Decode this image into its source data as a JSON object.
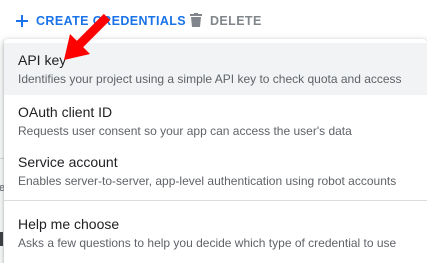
{
  "toolbar": {
    "create_label": "CREATE CREDENTIALS",
    "delete_label": "DELETE"
  },
  "menu": {
    "items": [
      {
        "title": "API key",
        "description": "Identifies your project using a simple API key to check quota and access",
        "highlighted": true
      },
      {
        "title": "OAuth client ID",
        "description": "Requests user consent so your app can access the user's data"
      },
      {
        "title": "Service account",
        "description": "Enables server-to-server, app-level authentication using robot accounts"
      },
      {
        "title": "Help me choose",
        "description": "Asks a few questions to help you decide which type of credential to use"
      }
    ]
  },
  "background": {
    "fragment_letter": "e"
  },
  "icons": {
    "create": "plus-icon",
    "delete": "trash-icon",
    "annotation": "red-arrow-icon"
  },
  "colors": {
    "accent": "#1a73e8",
    "muted_text": "#5f6368",
    "hover_bg": "#f1f3f4",
    "arrow": "#ff0000"
  }
}
